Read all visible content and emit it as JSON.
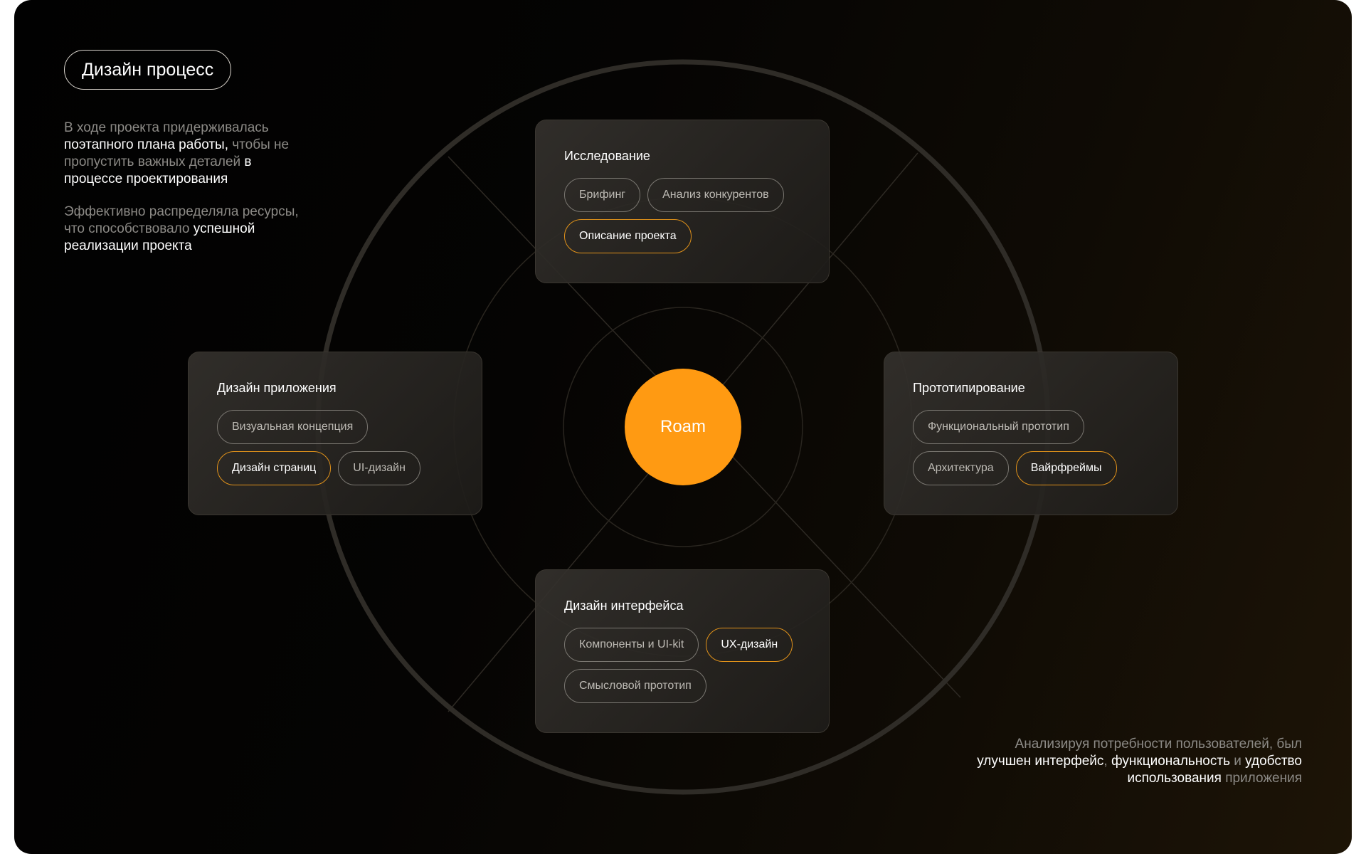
{
  "header": {
    "title": "Дизайн процесс"
  },
  "intro": {
    "p1_a": "В ходе проекта придерживалась ",
    "p1_b": "поэтапного плана работы,",
    "p1_c": " чтобы не пропустить важных деталей ",
    "p1_d": "в процессе проектирования",
    "p2_a": "Эффективно распределяла ресурсы, что способствовало ",
    "p2_b": "успешной реализации проекта"
  },
  "center": {
    "label": "Roam"
  },
  "cards": {
    "research": {
      "title": "Исследование",
      "tags": [
        "Брифинг",
        "Анализ конкурентов",
        "Описание проекта"
      ]
    },
    "app_design": {
      "title": "Дизайн приложения",
      "tags": [
        "Визуальная концепция",
        "Дизайн страниц",
        "UI-дизайн"
      ]
    },
    "prototyping": {
      "title": "Прототипирование",
      "tags": [
        "Функциональный прототип",
        "Архитектура",
        "Вайрфреймы"
      ]
    },
    "interface_design": {
      "title": "Дизайн интерфейса",
      "tags": [
        "Компоненты и UI-kit",
        "UX-дизайн",
        "Смысловой прототип"
      ]
    }
  },
  "outro": {
    "a": "Анализируя потребности пользователей, был ",
    "b": "улучшен  интерфейс",
    "c": ", ",
    "d": "функциональность",
    "e": " и ",
    "f": "удобство использования",
    "g": " приложения"
  },
  "colors": {
    "accent": "#ff9a12",
    "accent_border": "#e1921a",
    "background": "#050403",
    "card": "#2a2724",
    "muted_text": "#8c8a86"
  }
}
